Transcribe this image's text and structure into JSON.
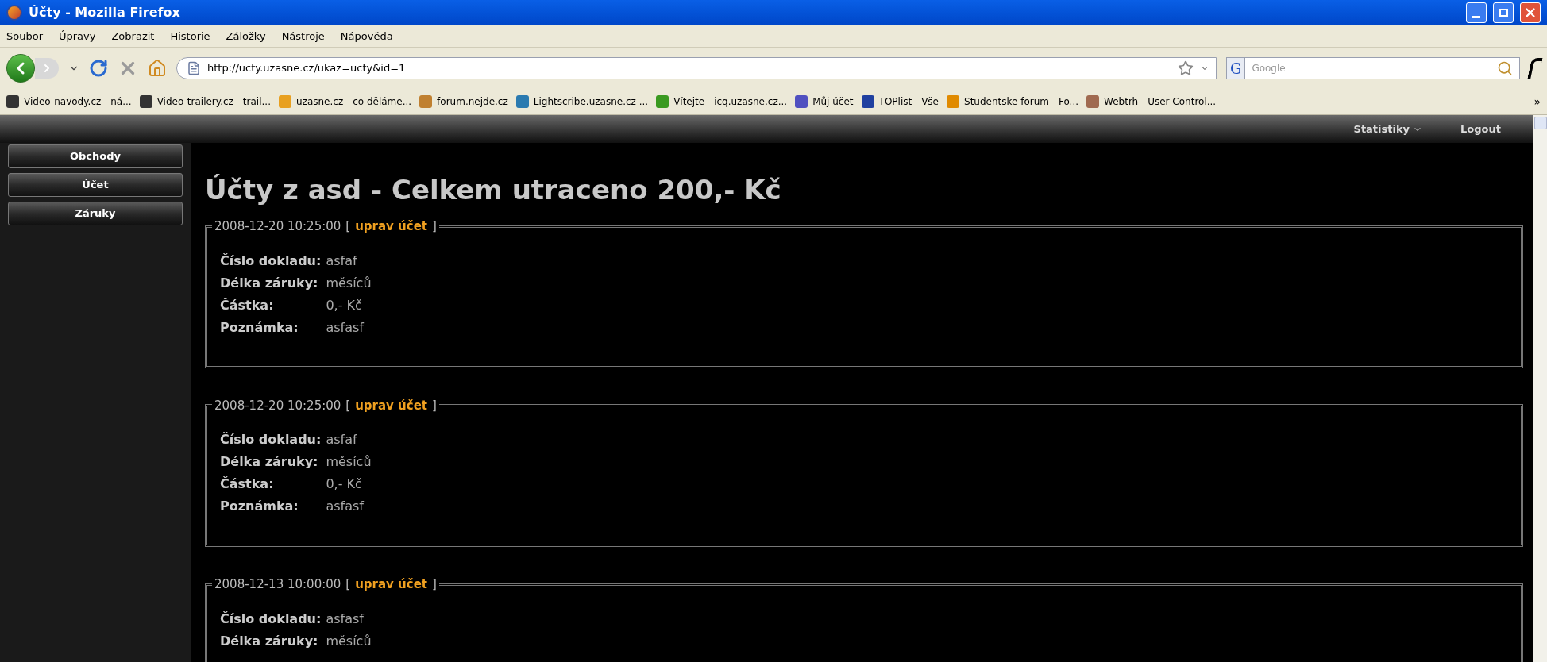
{
  "window": {
    "title": "Účty - Mozilla Firefox"
  },
  "menu": [
    "Soubor",
    "Úpravy",
    "Zobrazit",
    "Historie",
    "Záložky",
    "Nástroje",
    "Nápověda"
  ],
  "toolbar": {
    "url": "http://ucty.uzasne.cz/ukaz=ucty&id=1",
    "search_placeholder": "Google",
    "search_engine": "G"
  },
  "bookmarks": [
    {
      "label": "Video-navody.cz - ná...",
      "color": "#333333"
    },
    {
      "label": "Video-trailery.cz - trail...",
      "color": "#333333"
    },
    {
      "label": "uzasne.cz - co děláme...",
      "color": "#e8a020"
    },
    {
      "label": "forum.nejde.cz",
      "color": "#c08030"
    },
    {
      "label": "Lightscribe.uzasne.cz ...",
      "color": "#2a7ab0"
    },
    {
      "label": "Vítejte - icq.uzasne.cz...",
      "color": "#3a9a20"
    },
    {
      "label": "Můj účet",
      "color": "#5050c0"
    },
    {
      "label": "TOPlist - Vše",
      "color": "#2040a0"
    },
    {
      "label": "Studentske forum - Fo...",
      "color": "#e08a00"
    },
    {
      "label": "Webtrh - User Control...",
      "color": "#a06a50"
    }
  ],
  "bookmarks_overflow": "»",
  "topbar": {
    "items": [
      {
        "label": "Statistiky",
        "dropdown": true
      },
      {
        "label": "Logout",
        "dropdown": false
      }
    ]
  },
  "sidebar": {
    "items": [
      "Obchody",
      "Účet",
      "Záruky"
    ]
  },
  "heading": "Účty z asd - Celkem utraceno 200,- Kč",
  "receipts": [
    {
      "timestamp": "2008-12-20 10:25:00",
      "bracket_open": "[",
      "edit_link": "uprav účet",
      "bracket_close": "]",
      "fields": [
        {
          "label": "Číslo dokladu:",
          "value": "asfaf"
        },
        {
          "label": "Délka záruky:",
          "value": "měsíců"
        },
        {
          "label": "Částka:",
          "value": "0,- Kč"
        },
        {
          "label": "Poznámka:",
          "value": "asfasf"
        }
      ]
    },
    {
      "timestamp": "2008-12-20 10:25:00",
      "bracket_open": "[",
      "edit_link": "uprav účet",
      "bracket_close": "]",
      "fields": [
        {
          "label": "Číslo dokladu:",
          "value": "asfaf"
        },
        {
          "label": "Délka záruky:",
          "value": "měsíců"
        },
        {
          "label": "Částka:",
          "value": "0,- Kč"
        },
        {
          "label": "Poznámka:",
          "value": "asfasf"
        }
      ]
    },
    {
      "timestamp": "2008-12-13 10:00:00",
      "bracket_open": "[",
      "edit_link": "uprav účet",
      "bracket_close": "]",
      "fields": [
        {
          "label": "Číslo dokladu:",
          "value": "asfasf"
        },
        {
          "label": "Délka záruky:",
          "value": "měsíců"
        }
      ]
    }
  ]
}
